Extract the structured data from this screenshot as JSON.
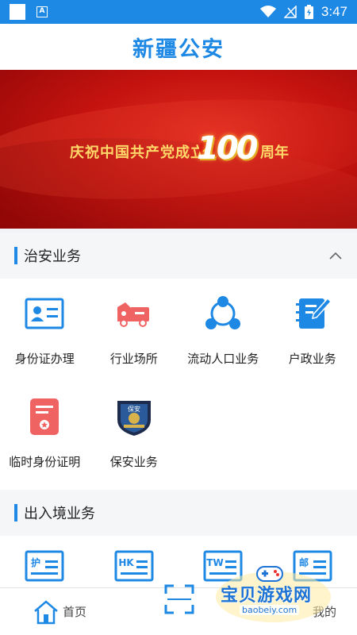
{
  "status": {
    "time": "3:47",
    "battery": "⚡"
  },
  "header": {
    "title": "新疆公安"
  },
  "banner": {
    "text": "庆祝中国共产党成立",
    "number": "100",
    "suffix": "周年"
  },
  "sections": [
    {
      "title": "治安业务",
      "items": [
        {
          "label": "身份证办理",
          "icon": "id-card-icon"
        },
        {
          "label": "行业场所",
          "icon": "truck-icon"
        },
        {
          "label": "流动人口业务",
          "icon": "network-icon"
        },
        {
          "label": "户政业务",
          "icon": "notebook-pen-icon"
        },
        {
          "label": "临时身份证明",
          "icon": "temp-certificate-icon"
        },
        {
          "label": "保安业务",
          "icon": "security-badge-icon"
        }
      ],
      "badge_text": "保安"
    },
    {
      "title": "出入境业务",
      "items": [
        {
          "tag": "护",
          "icon": "passport-card-icon"
        },
        {
          "tag": "HK",
          "icon": "hk-permit-icon"
        },
        {
          "tag": "TW",
          "icon": "tw-permit-icon"
        },
        {
          "tag": "邮",
          "icon": "mail-card-icon"
        }
      ]
    }
  ],
  "bottom_nav": {
    "home": "首页",
    "mine": "我的"
  },
  "watermark": {
    "title": "宝贝游戏网",
    "sub": "baobeiy.com"
  },
  "colors": {
    "primary": "#1e88e5",
    "banner_red": "#c4130f",
    "accent_pink": "#f06363"
  }
}
